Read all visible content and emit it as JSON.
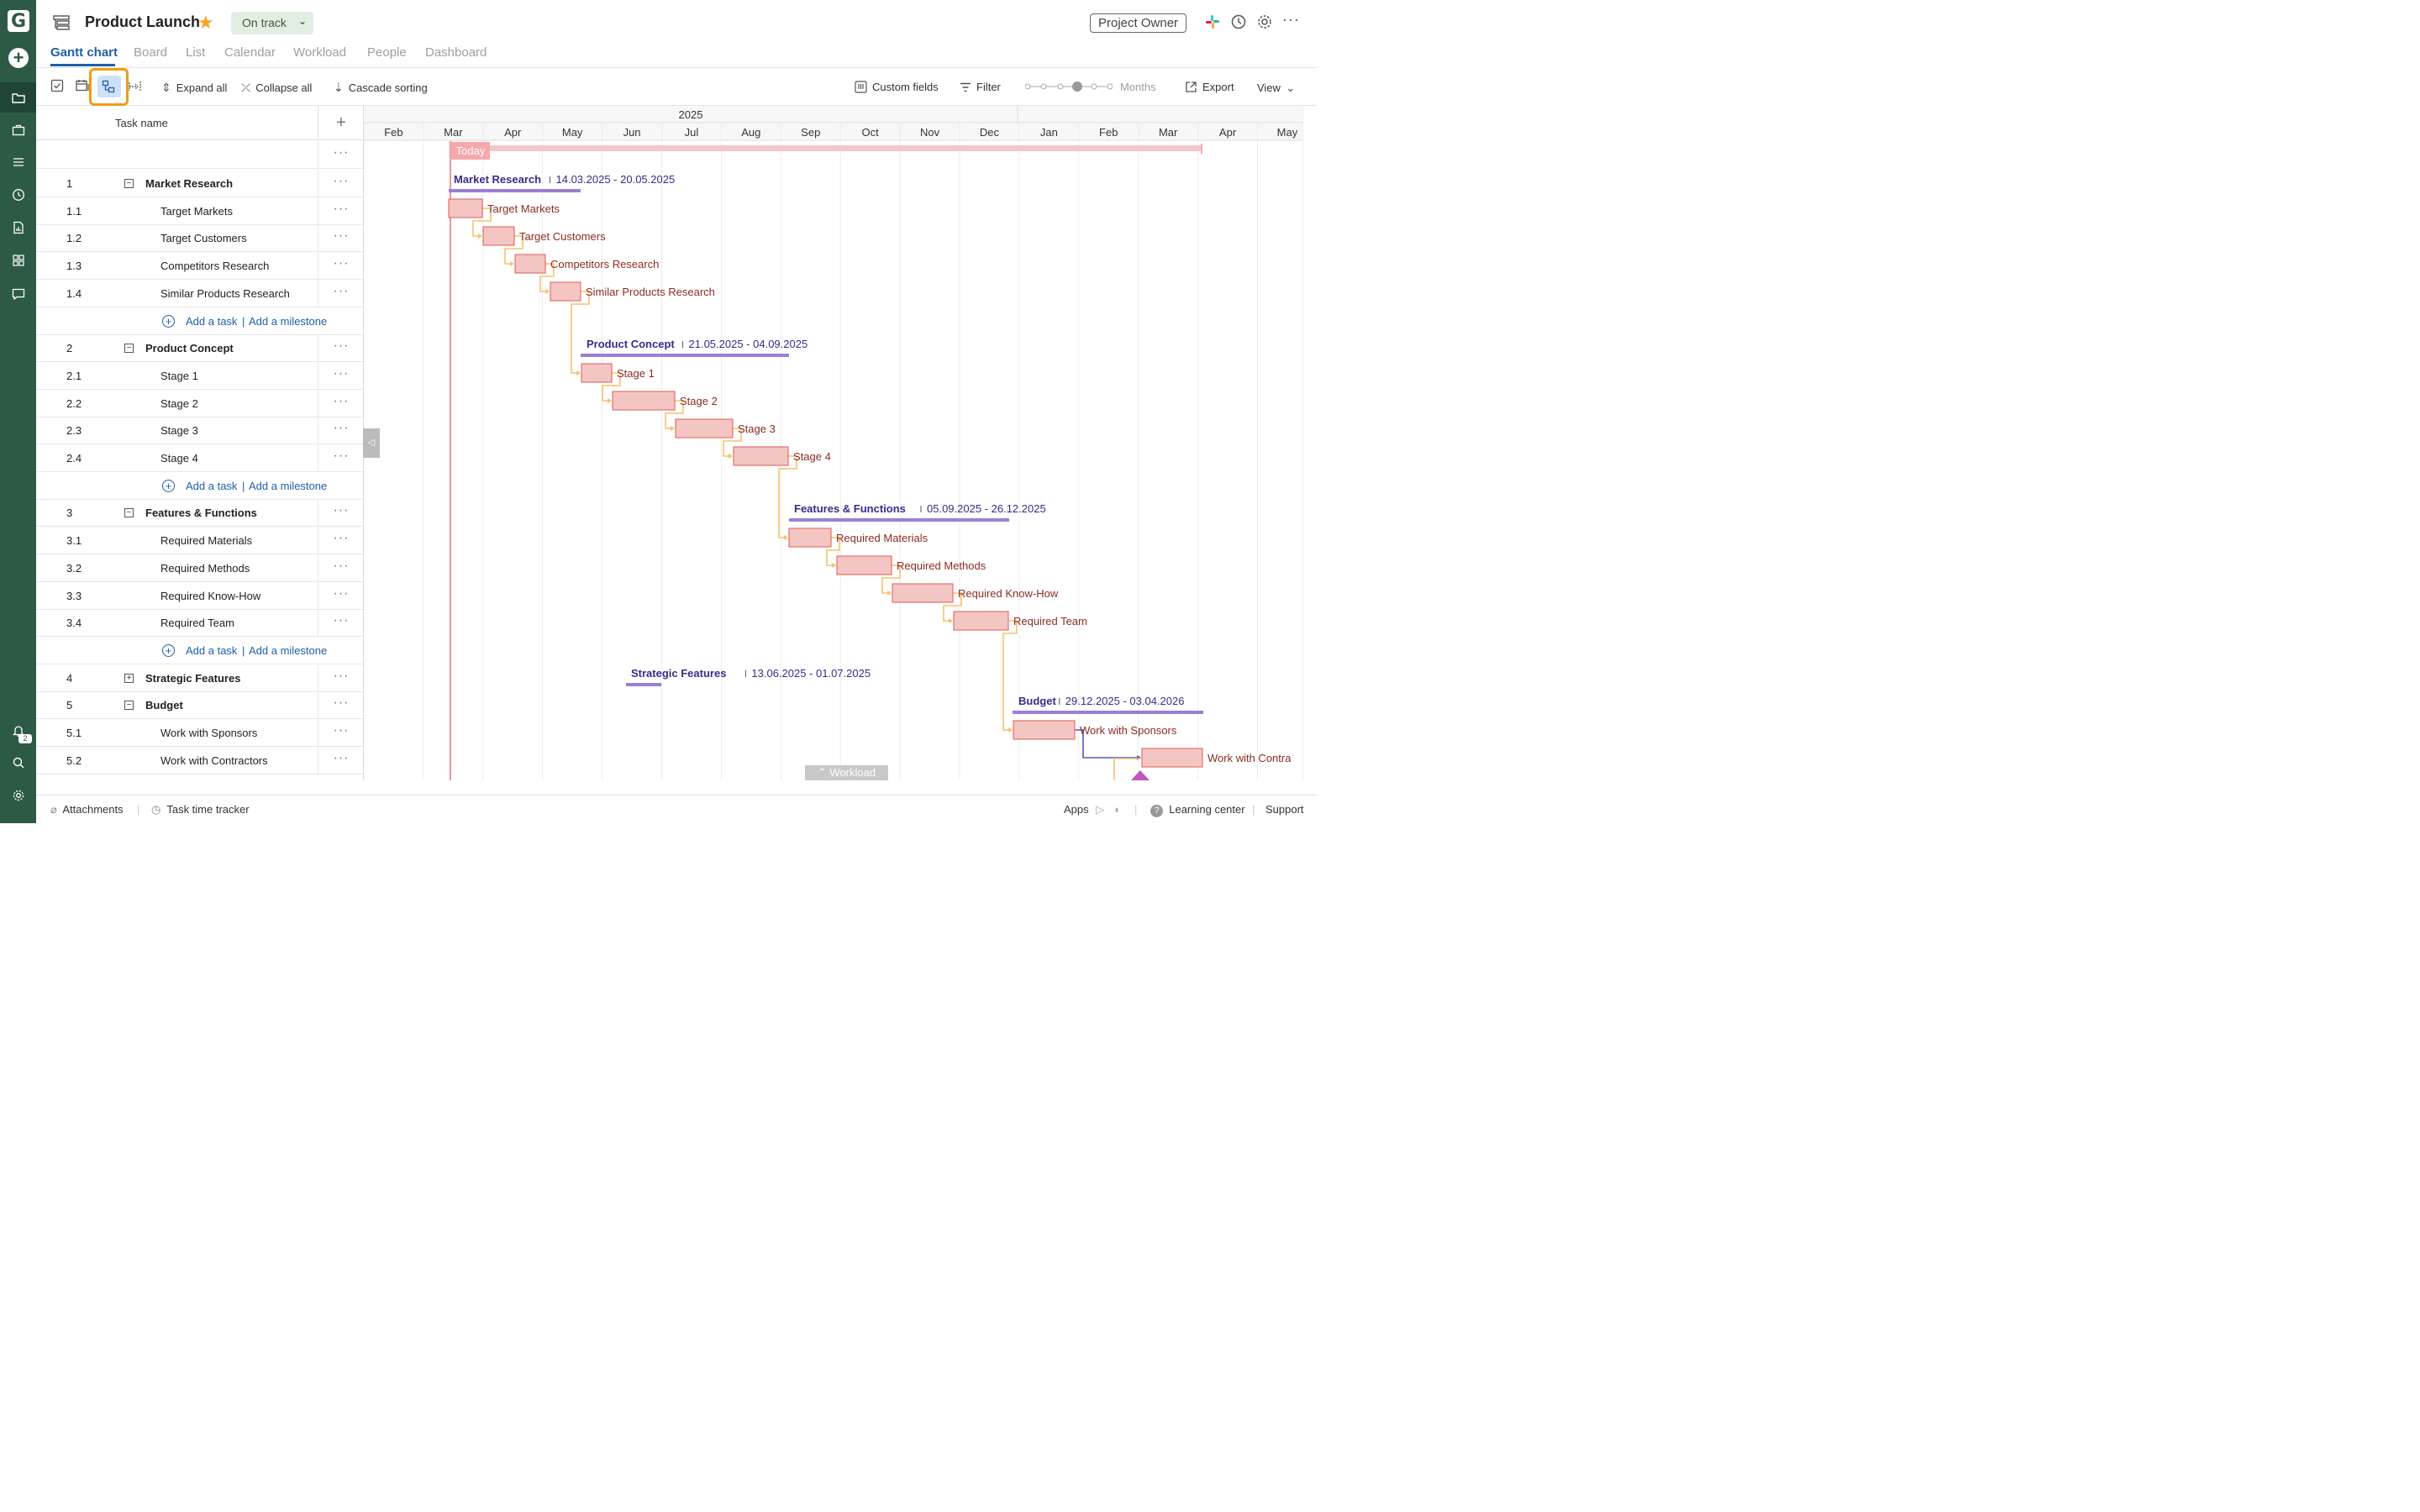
{
  "rail": {
    "logo": "G",
    "notification_count": "2"
  },
  "header": {
    "title": "Product Launch",
    "status": "On track",
    "owner_button": "Project Owner"
  },
  "tabs": [
    {
      "label": "Gantt chart",
      "active": true
    },
    {
      "label": "Board"
    },
    {
      "label": "List"
    },
    {
      "label": "Calendar"
    },
    {
      "label": "Workload"
    },
    {
      "label": "People"
    },
    {
      "label": "Dashboard"
    }
  ],
  "toolbar": {
    "expand_all": "Expand all",
    "collapse_all": "Collapse all",
    "cascade_sorting": "Cascade sorting",
    "custom_fields": "Custom fields",
    "filter": "Filter",
    "zoom_level": "Months",
    "export": "Export",
    "view": "View"
  },
  "grid": {
    "column_header": "Task name",
    "add_task": "Add a task",
    "add_milestone": "Add a milestone",
    "rows": [
      {
        "num": "",
        "name": "",
        "kind": "blank"
      },
      {
        "num": "1",
        "name": "Market Research",
        "kind": "group",
        "toggle": "−"
      },
      {
        "num": "1.1",
        "name": "Target Markets",
        "kind": "task"
      },
      {
        "num": "1.2",
        "name": "Target Customers",
        "kind": "task"
      },
      {
        "num": "1.3",
        "name": "Competitors Research",
        "kind": "task"
      },
      {
        "num": "1.4",
        "name": "Similar Products Research",
        "kind": "task"
      },
      {
        "kind": "add"
      },
      {
        "num": "2",
        "name": "Product Concept",
        "kind": "group",
        "toggle": "−"
      },
      {
        "num": "2.1",
        "name": "Stage 1",
        "kind": "task"
      },
      {
        "num": "2.2",
        "name": "Stage 2",
        "kind": "task"
      },
      {
        "num": "2.3",
        "name": "Stage 3",
        "kind": "task"
      },
      {
        "num": "2.4",
        "name": "Stage 4",
        "kind": "task"
      },
      {
        "kind": "add"
      },
      {
        "num": "3",
        "name": "Features & Functions",
        "kind": "group",
        "toggle": "−"
      },
      {
        "num": "3.1",
        "name": "Required Materials",
        "kind": "task"
      },
      {
        "num": "3.2",
        "name": "Required Methods",
        "kind": "task"
      },
      {
        "num": "3.3",
        "name": "Required Know-How",
        "kind": "task"
      },
      {
        "num": "3.4",
        "name": "Required Team",
        "kind": "task"
      },
      {
        "kind": "add"
      },
      {
        "num": "4",
        "name": "Strategic Features",
        "kind": "group",
        "toggle": "+"
      },
      {
        "num": "5",
        "name": "Budget",
        "kind": "group",
        "toggle": "−"
      },
      {
        "num": "5.1",
        "name": "Work with Sponsors",
        "kind": "task"
      },
      {
        "num": "5.2",
        "name": "Work with Contractors",
        "kind": "task"
      }
    ]
  },
  "timeline": {
    "year": "2025",
    "months": [
      "Feb",
      "Mar",
      "Apr",
      "May",
      "Jun",
      "Jul",
      "Aug",
      "Sep",
      "Oct",
      "Nov",
      "Dec",
      "Jan",
      "Feb",
      "Mar",
      "Apr",
      "May"
    ],
    "today_label": "Today",
    "groups": [
      {
        "name": "Market Research",
        "dates": "14.03.2025 - 20.05.2025"
      },
      {
        "name": "Product Concept",
        "dates": "21.05.2025 - 04.09.2025"
      },
      {
        "name": "Features & Functions",
        "dates": "05.09.2025 - 26.12.2025"
      },
      {
        "name": "Strategic Features",
        "dates": "13.06.2025 - 01.07.2025"
      },
      {
        "name": "Budget",
        "dates": "29.12.2025 - 03.04.2026"
      }
    ],
    "tasks": [
      "Target Markets",
      "Target Customers",
      "Competitors Research",
      "Similar Products Research",
      "Stage 1",
      "Stage 2",
      "Stage 3",
      "Stage 4",
      "Required Materials",
      "Required Methods",
      "Required Know-How",
      "Required Team",
      "Work with Sponsors",
      "Work with Contra"
    ],
    "workload_toggle": "Workload"
  },
  "footer": {
    "attachments": "Attachments",
    "time_tracker": "Task time tracker",
    "apps": "Apps",
    "learning_center": "Learning center",
    "support": "Support"
  },
  "colors": {
    "rail": "#2d5a45",
    "accent": "#1f5fa8",
    "group_bar": "#9b7fd4",
    "task_bar_fill": "#f4c6c3",
    "task_bar_border": "#e05a4f",
    "dependency": "#f5c16c",
    "today": "#e05a6a",
    "highlight": "#f39c12"
  }
}
